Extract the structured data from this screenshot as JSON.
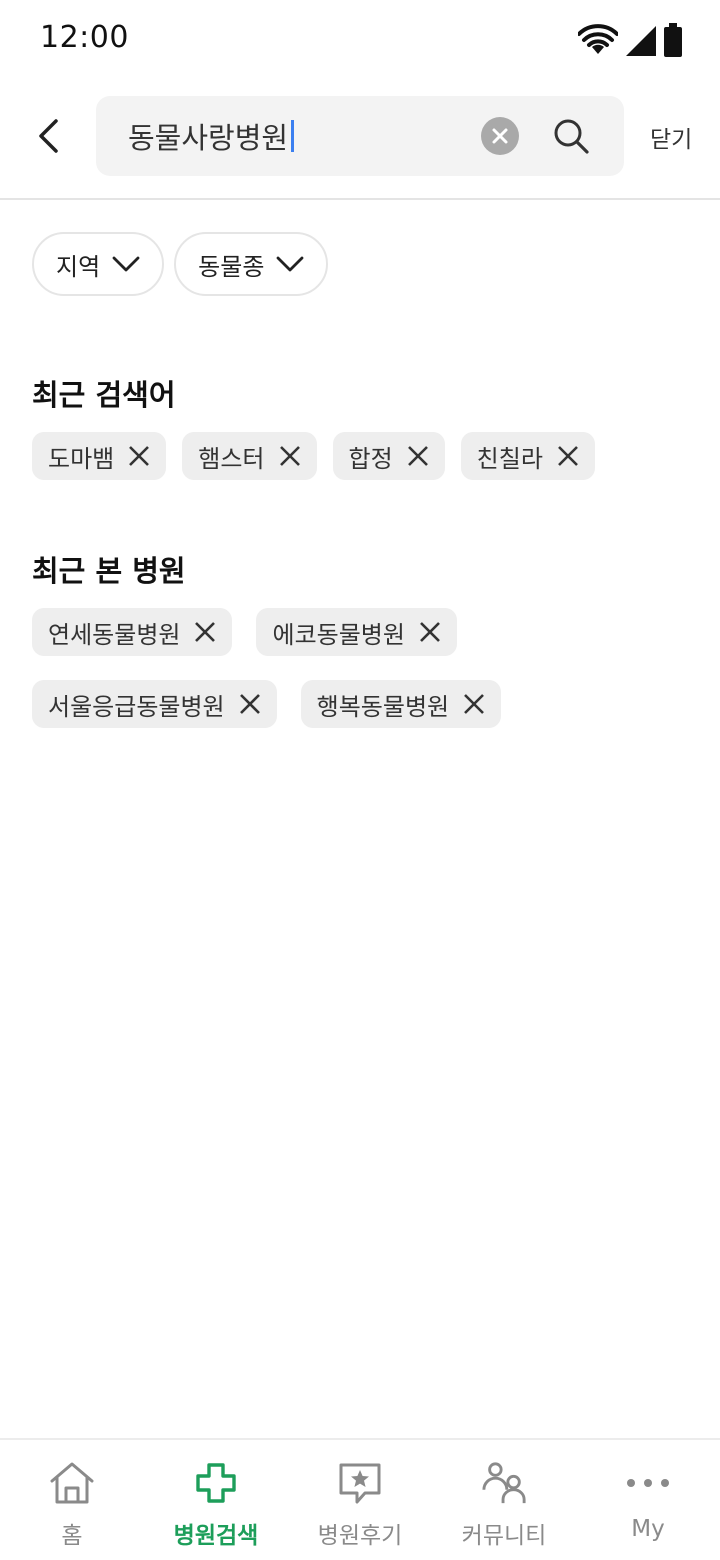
{
  "status_bar": {
    "time": "12:00"
  },
  "search": {
    "query": "동물사랑병원",
    "close_label": "닫기"
  },
  "filters": [
    {
      "label": "지역"
    },
    {
      "label": "동물종"
    }
  ],
  "recent_searches": {
    "title": "최근 검색어",
    "items": [
      "도마뱀",
      "햄스터",
      "합정",
      "친칠라"
    ]
  },
  "recent_hospitals": {
    "title": "최근 본 병원",
    "items": [
      "연세동물병원",
      "에코동물병원",
      "서울응급동물병원",
      "행복동물병원"
    ]
  },
  "bottom_nav": {
    "active": "병원검색",
    "accent_color": "#1d9e5a",
    "items": [
      {
        "label": "홈",
        "icon": "home-icon"
      },
      {
        "label": "병원검색",
        "icon": "medical-cross-icon"
      },
      {
        "label": "병원후기",
        "icon": "review-star-icon"
      },
      {
        "label": "커뮤니티",
        "icon": "community-icon"
      },
      {
        "label": "My",
        "icon": "more-dots-icon"
      }
    ]
  }
}
